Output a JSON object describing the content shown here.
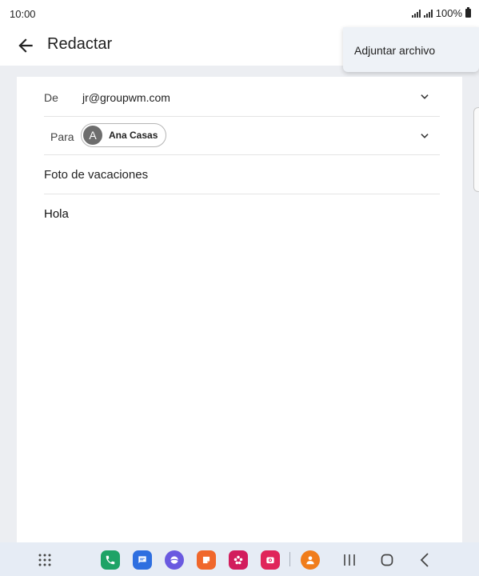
{
  "status": {
    "time": "10:00",
    "battery": "100%"
  },
  "appbar": {
    "title": "Redactar"
  },
  "overflow_menu": {
    "items": [
      {
        "label": "Adjuntar archivo"
      }
    ]
  },
  "compose": {
    "from_label": "De",
    "from_value": "jr@groupwm.com",
    "to_label": "Para",
    "recipient": {
      "initial": "A",
      "name": "Ana Casas"
    },
    "subject": "Foto de vacaciones",
    "body": "Hola"
  },
  "colors": {
    "phone": "#1ea366",
    "messages": "#2e6fe0",
    "internet": "#6a5ae0",
    "notes": "#f0672b",
    "gallery": "#d21d5d",
    "camera": "#e0255a",
    "contacts": "#f07d1b"
  },
  "dock": [
    "apps-grid-icon",
    "phone-icon",
    "messages-icon",
    "internet-icon",
    "notes-icon",
    "gallery-icon",
    "camera-icon",
    "contacts-icon"
  ],
  "nav": [
    "recents-icon",
    "home-icon",
    "back-icon"
  ]
}
